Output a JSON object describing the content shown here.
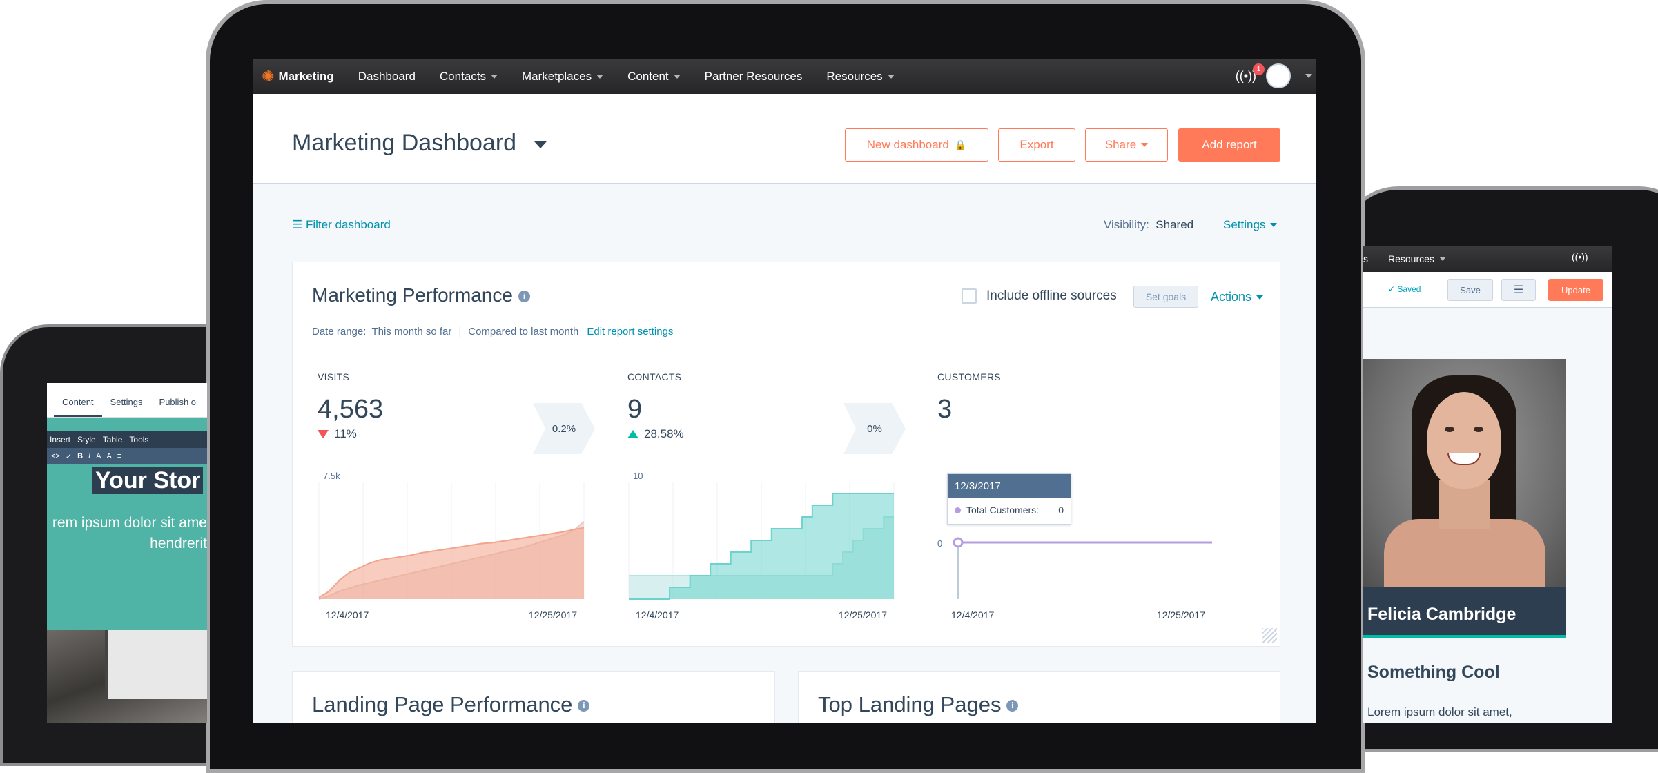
{
  "nav": {
    "brand": "Marketing",
    "items": [
      {
        "label": "Dashboard",
        "caret": false
      },
      {
        "label": "Contacts",
        "caret": true
      },
      {
        "label": "Marketplaces",
        "caret": true
      },
      {
        "label": "Content",
        "caret": true
      },
      {
        "label": "Partner Resources",
        "caret": false
      },
      {
        "label": "Resources",
        "caret": true
      }
    ],
    "notification_count": "1"
  },
  "header": {
    "title": "Marketing Dashboard",
    "buttons": {
      "new_dashboard": "New dashboard",
      "export": "Export",
      "share": "Share",
      "add_report": "Add report"
    }
  },
  "toolbar": {
    "filter": "Filter dashboard",
    "visibility_label": "Visibility:",
    "visibility_value": "Shared",
    "settings": "Settings"
  },
  "performance": {
    "title": "Marketing Performance",
    "offline_label": "Include offline sources",
    "set_goals": "Set goals",
    "actions": "Actions",
    "date_range_label": "Date range:",
    "date_range_value": "This month so far",
    "compared": "Compared to last month",
    "edit_settings": "Edit report settings",
    "kpis": [
      {
        "label": "VISITS",
        "value": "4,563",
        "change": "11%",
        "direction": "down",
        "conversion": "0.2%"
      },
      {
        "label": "CONTACTS",
        "value": "9",
        "change": "28.58%",
        "direction": "up",
        "conversion": "0%"
      },
      {
        "label": "CUSTOMERS",
        "value": "3"
      }
    ],
    "tooltip": {
      "date": "12/3/2017",
      "label": "Total Customers:",
      "value": "0"
    }
  },
  "chart_data": [
    {
      "type": "area",
      "ytick": "7.5k",
      "ylim": [
        0,
        7500
      ],
      "xticks": [
        "12/4/2017",
        "12/25/2017"
      ],
      "x": [
        0,
        1,
        2,
        3,
        4,
        5,
        6,
        7,
        8,
        9,
        10,
        11,
        12,
        13,
        14,
        15,
        16,
        17,
        18,
        19,
        20,
        21,
        22,
        23,
        24,
        25,
        26
      ],
      "series": [
        {
          "color": "#f2a48c",
          "values": [
            100,
            500,
            1200,
            1700,
            2000,
            2300,
            2500,
            2600,
            2700,
            2800,
            2950,
            3050,
            3150,
            3250,
            3350,
            3450,
            3550,
            3600,
            3700,
            3800,
            3900,
            4000,
            4100,
            4200,
            4300,
            4450,
            4563
          ]
        },
        {
          "color": "#e6c9c0",
          "values": [
            0,
            200,
            500,
            700,
            900,
            1050,
            1200,
            1350,
            1500,
            1650,
            1800,
            1950,
            2100,
            2250,
            2400,
            2550,
            2700,
            2850,
            3000,
            3150,
            3300,
            3500,
            3700,
            3900,
            4100,
            4400,
            4950
          ]
        }
      ]
    },
    {
      "type": "area",
      "ytick": "10",
      "ylim": [
        0,
        10
      ],
      "xticks": [
        "12/4/2017",
        "12/25/2017"
      ],
      "x": [
        0,
        1,
        2,
        3,
        4,
        5,
        6,
        7,
        8,
        9,
        10,
        11,
        12,
        13,
        14,
        15,
        16,
        17,
        18,
        19,
        20,
        21,
        22,
        23,
        24,
        25,
        26
      ],
      "series": [
        {
          "color": "#6cd3cc",
          "values": [
            0,
            0,
            0,
            0,
            1,
            1,
            2,
            2,
            3,
            3,
            4,
            4,
            5,
            5,
            6,
            6,
            6,
            7,
            8,
            8,
            9,
            9,
            9,
            9,
            9,
            9,
            9
          ]
        },
        {
          "color": "#b7e4e1",
          "values": [
            2,
            2,
            2,
            2,
            2,
            2,
            2,
            2,
            2,
            2,
            2,
            2,
            2,
            2,
            2,
            2,
            2,
            2,
            2,
            2,
            3,
            4,
            5,
            6,
            6,
            7,
            7
          ]
        }
      ]
    },
    {
      "type": "line",
      "ytick": "0",
      "ylim": [
        0,
        10
      ],
      "xticks": [
        "12/4/2017",
        "12/25/2017"
      ],
      "x": [
        0,
        26
      ],
      "series": [
        {
          "color": "#b49ee0",
          "values": [
            0,
            0
          ]
        }
      ]
    }
  ],
  "bottom": {
    "landing_pages": "Landing Page Performance",
    "top_landing": "Top Landing Pages"
  },
  "left_tablet": {
    "tabs": [
      "Content",
      "Settings",
      "Publish o"
    ],
    "toolbar": [
      "Insert",
      "Style",
      "Table",
      "Tools"
    ],
    "hero_title": "Your Stor",
    "hero_line1": "rem ipsum dolor sit ame",
    "hero_line2": "hendrerit"
  },
  "right_tablet": {
    "nav_partial": "s",
    "nav_resources": "Resources",
    "saved": "Saved",
    "save": "Save",
    "update": "Update",
    "name": "Felicia Cambridge",
    "heading": "Something Cool",
    "body": "Lorem ipsum dolor sit amet,"
  }
}
